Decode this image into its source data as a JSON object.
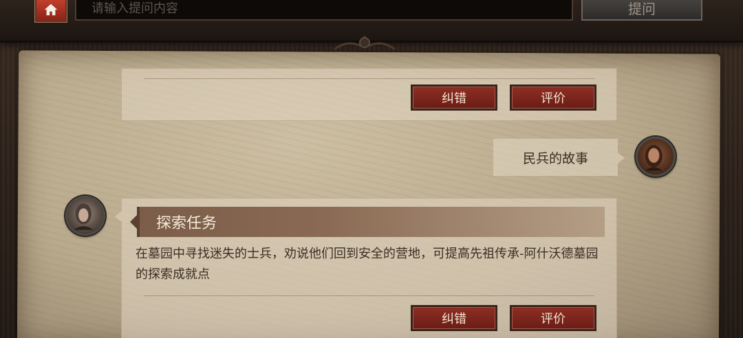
{
  "header": {
    "search_placeholder": "请输入提问内容",
    "ask_label": "提问"
  },
  "answer_top": {
    "correct_label": "纠错",
    "rate_label": "评价"
  },
  "user_message": {
    "text": "民兵的故事"
  },
  "answer_bottom": {
    "title": "探索任务",
    "body": "在墓园中寻找迷失的士兵，劝说他们回到安全的营地，可提高先祖传承-阿什沃德墓园的探索成就点",
    "correct_label": "纠错",
    "rate_label": "评价"
  },
  "icons": {
    "home": "home-icon",
    "ornament": "skull-ornament-icon"
  },
  "colors": {
    "accent_red": "#8e2e24",
    "parchment": "#cdbfa3",
    "banner": "#7b5d49"
  }
}
